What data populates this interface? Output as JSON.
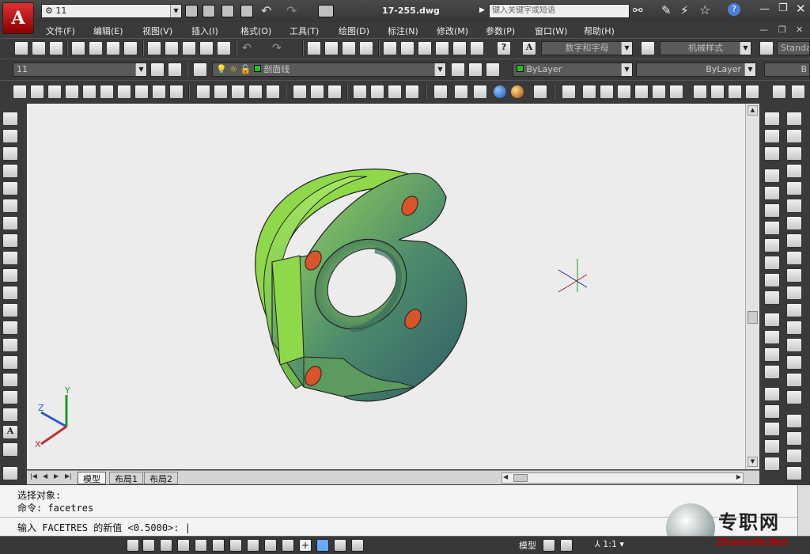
{
  "app": {
    "title": "17-255.dwg",
    "logo_letter": "A"
  },
  "quick_access": {
    "workspace_value": "11"
  },
  "search": {
    "placeholder": "键入关键字或短语"
  },
  "menu": [
    "文件(F)",
    "编辑(E)",
    "视图(V)",
    "插入(I)",
    "格式(O)",
    "工具(T)",
    "绘图(D)",
    "标注(N)",
    "修改(M)",
    "参数(P)",
    "窗口(W)",
    "帮助(H)"
  ],
  "styles": {
    "text_style": "数字和字母",
    "dim_style": "机械样式",
    "table_style": "Standard"
  },
  "layers": {
    "layer_state": "11",
    "current_layer": "剖面线",
    "color": "ByLayer",
    "linetype": "ByLayer",
    "lineweight": "B"
  },
  "colors": {
    "part_green": "#8fd84a",
    "part_dark": "#3a6e6a",
    "hole": "#d9542a",
    "accent_red": "#c00000"
  },
  "tabs": [
    "模型",
    "布局1",
    "布局2"
  ],
  "command": {
    "line1": "选择对象:",
    "line2": "命令: facetres",
    "prompt": "输入 FACETRES 的新值 <0.5000>:"
  },
  "statusbar": {
    "model_label": "模型",
    "scale": "1:1"
  },
  "watermark": {
    "brand": "专职网",
    "url": "Zhuanzhi.Net"
  }
}
